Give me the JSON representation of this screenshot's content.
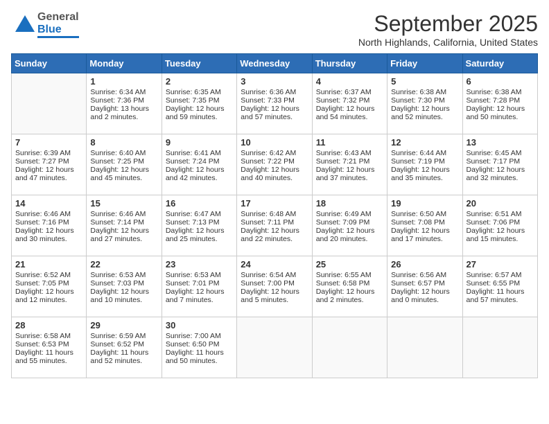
{
  "header": {
    "logo_general": "General",
    "logo_blue": "Blue",
    "month_title": "September 2025",
    "subtitle": "North Highlands, California, United States"
  },
  "days_of_week": [
    "Sunday",
    "Monday",
    "Tuesday",
    "Wednesday",
    "Thursday",
    "Friday",
    "Saturday"
  ],
  "weeks": [
    [
      {
        "day": "",
        "sunrise": "",
        "sunset": "",
        "daylight": ""
      },
      {
        "day": "1",
        "sunrise": "Sunrise: 6:34 AM",
        "sunset": "Sunset: 7:36 PM",
        "daylight": "Daylight: 13 hours and 2 minutes."
      },
      {
        "day": "2",
        "sunrise": "Sunrise: 6:35 AM",
        "sunset": "Sunset: 7:35 PM",
        "daylight": "Daylight: 12 hours and 59 minutes."
      },
      {
        "day": "3",
        "sunrise": "Sunrise: 6:36 AM",
        "sunset": "Sunset: 7:33 PM",
        "daylight": "Daylight: 12 hours and 57 minutes."
      },
      {
        "day": "4",
        "sunrise": "Sunrise: 6:37 AM",
        "sunset": "Sunset: 7:32 PM",
        "daylight": "Daylight: 12 hours and 54 minutes."
      },
      {
        "day": "5",
        "sunrise": "Sunrise: 6:38 AM",
        "sunset": "Sunset: 7:30 PM",
        "daylight": "Daylight: 12 hours and 52 minutes."
      },
      {
        "day": "6",
        "sunrise": "Sunrise: 6:38 AM",
        "sunset": "Sunset: 7:28 PM",
        "daylight": "Daylight: 12 hours and 50 minutes."
      }
    ],
    [
      {
        "day": "7",
        "sunrise": "Sunrise: 6:39 AM",
        "sunset": "Sunset: 7:27 PM",
        "daylight": "Daylight: 12 hours and 47 minutes."
      },
      {
        "day": "8",
        "sunrise": "Sunrise: 6:40 AM",
        "sunset": "Sunset: 7:25 PM",
        "daylight": "Daylight: 12 hours and 45 minutes."
      },
      {
        "day": "9",
        "sunrise": "Sunrise: 6:41 AM",
        "sunset": "Sunset: 7:24 PM",
        "daylight": "Daylight: 12 hours and 42 minutes."
      },
      {
        "day": "10",
        "sunrise": "Sunrise: 6:42 AM",
        "sunset": "Sunset: 7:22 PM",
        "daylight": "Daylight: 12 hours and 40 minutes."
      },
      {
        "day": "11",
        "sunrise": "Sunrise: 6:43 AM",
        "sunset": "Sunset: 7:21 PM",
        "daylight": "Daylight: 12 hours and 37 minutes."
      },
      {
        "day": "12",
        "sunrise": "Sunrise: 6:44 AM",
        "sunset": "Sunset: 7:19 PM",
        "daylight": "Daylight: 12 hours and 35 minutes."
      },
      {
        "day": "13",
        "sunrise": "Sunrise: 6:45 AM",
        "sunset": "Sunset: 7:17 PM",
        "daylight": "Daylight: 12 hours and 32 minutes."
      }
    ],
    [
      {
        "day": "14",
        "sunrise": "Sunrise: 6:46 AM",
        "sunset": "Sunset: 7:16 PM",
        "daylight": "Daylight: 12 hours and 30 minutes."
      },
      {
        "day": "15",
        "sunrise": "Sunrise: 6:46 AM",
        "sunset": "Sunset: 7:14 PM",
        "daylight": "Daylight: 12 hours and 27 minutes."
      },
      {
        "day": "16",
        "sunrise": "Sunrise: 6:47 AM",
        "sunset": "Sunset: 7:13 PM",
        "daylight": "Daylight: 12 hours and 25 minutes."
      },
      {
        "day": "17",
        "sunrise": "Sunrise: 6:48 AM",
        "sunset": "Sunset: 7:11 PM",
        "daylight": "Daylight: 12 hours and 22 minutes."
      },
      {
        "day": "18",
        "sunrise": "Sunrise: 6:49 AM",
        "sunset": "Sunset: 7:09 PM",
        "daylight": "Daylight: 12 hours and 20 minutes."
      },
      {
        "day": "19",
        "sunrise": "Sunrise: 6:50 AM",
        "sunset": "Sunset: 7:08 PM",
        "daylight": "Daylight: 12 hours and 17 minutes."
      },
      {
        "day": "20",
        "sunrise": "Sunrise: 6:51 AM",
        "sunset": "Sunset: 7:06 PM",
        "daylight": "Daylight: 12 hours and 15 minutes."
      }
    ],
    [
      {
        "day": "21",
        "sunrise": "Sunrise: 6:52 AM",
        "sunset": "Sunset: 7:05 PM",
        "daylight": "Daylight: 12 hours and 12 minutes."
      },
      {
        "day": "22",
        "sunrise": "Sunrise: 6:53 AM",
        "sunset": "Sunset: 7:03 PM",
        "daylight": "Daylight: 12 hours and 10 minutes."
      },
      {
        "day": "23",
        "sunrise": "Sunrise: 6:53 AM",
        "sunset": "Sunset: 7:01 PM",
        "daylight": "Daylight: 12 hours and 7 minutes."
      },
      {
        "day": "24",
        "sunrise": "Sunrise: 6:54 AM",
        "sunset": "Sunset: 7:00 PM",
        "daylight": "Daylight: 12 hours and 5 minutes."
      },
      {
        "day": "25",
        "sunrise": "Sunrise: 6:55 AM",
        "sunset": "Sunset: 6:58 PM",
        "daylight": "Daylight: 12 hours and 2 minutes."
      },
      {
        "day": "26",
        "sunrise": "Sunrise: 6:56 AM",
        "sunset": "Sunset: 6:57 PM",
        "daylight": "Daylight: 12 hours and 0 minutes."
      },
      {
        "day": "27",
        "sunrise": "Sunrise: 6:57 AM",
        "sunset": "Sunset: 6:55 PM",
        "daylight": "Daylight: 11 hours and 57 minutes."
      }
    ],
    [
      {
        "day": "28",
        "sunrise": "Sunrise: 6:58 AM",
        "sunset": "Sunset: 6:53 PM",
        "daylight": "Daylight: 11 hours and 55 minutes."
      },
      {
        "day": "29",
        "sunrise": "Sunrise: 6:59 AM",
        "sunset": "Sunset: 6:52 PM",
        "daylight": "Daylight: 11 hours and 52 minutes."
      },
      {
        "day": "30",
        "sunrise": "Sunrise: 7:00 AM",
        "sunset": "Sunset: 6:50 PM",
        "daylight": "Daylight: 11 hours and 50 minutes."
      },
      {
        "day": "",
        "sunrise": "",
        "sunset": "",
        "daylight": ""
      },
      {
        "day": "",
        "sunrise": "",
        "sunset": "",
        "daylight": ""
      },
      {
        "day": "",
        "sunrise": "",
        "sunset": "",
        "daylight": ""
      },
      {
        "day": "",
        "sunrise": "",
        "sunset": "",
        "daylight": ""
      }
    ]
  ]
}
